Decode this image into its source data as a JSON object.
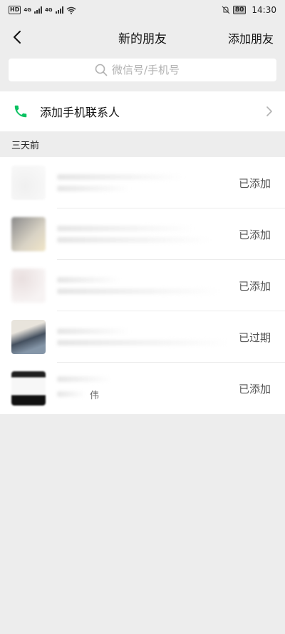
{
  "status_bar": {
    "left": {
      "hd": "HD",
      "signal1": "4G",
      "signal2": "4G"
    },
    "right": {
      "battery": "80",
      "time": "14:30"
    }
  },
  "navbar": {
    "title": "新的朋友",
    "action": "添加朋友"
  },
  "search": {
    "placeholder": "微信号/手机号"
  },
  "add_contacts": {
    "label": "添加手机联系人"
  },
  "section": {
    "header": "三天前"
  },
  "requests": [
    {
      "status": "已添加",
      "desc": ""
    },
    {
      "status": "已添加",
      "desc": ""
    },
    {
      "status": "已添加",
      "desc": ""
    },
    {
      "status": "已过期",
      "desc": ""
    },
    {
      "status": "已添加",
      "desc": "伟"
    }
  ],
  "colors": {
    "background": "#ededed",
    "phone_icon": "#07c160",
    "muted": "#b2b2b2"
  }
}
